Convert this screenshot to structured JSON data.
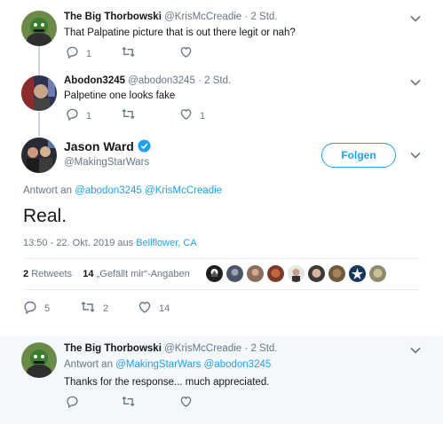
{
  "tweet1": {
    "name": "The Big Thorbowski",
    "handle": "@KrisMcCreadie",
    "sep": "·",
    "time": "2 Std.",
    "text": "That Palpatine picture that is out there legit or nah?",
    "reply_count": "1",
    "retweet_count": "",
    "like_count": ""
  },
  "tweet2": {
    "name": "Abodon3245",
    "handle": "@abodon3245",
    "sep": "·",
    "time": "2 Std.",
    "text": "Palpetine one looks fake",
    "reply_count": "1",
    "retweet_count": "",
    "like_count": "1"
  },
  "main": {
    "name": "Jason Ward",
    "handle": "@MakingStarWars",
    "follow_label": "Folgen",
    "reply_prefix": "Antwort an",
    "reply_mentions": "@abodon3245 @KrisMcCreadie",
    "text": "Real.",
    "timestamp": "13:50 - 22. Okt. 2019 aus",
    "location": "Bellflower, CA",
    "retweets_num": "2",
    "retweets_label": "Retweets",
    "likes_num": "14",
    "likes_label": "„Gefällt mir“-Angaben",
    "reply_count": "5",
    "retweet_count": "2",
    "like_count": "14"
  },
  "reply": {
    "name": "The Big Thorbowski",
    "handle": "@KrisMcCreadie",
    "sep": "·",
    "time": "2 Std.",
    "reply_prefix": "Antwort an",
    "reply_mentions": "@MakingStarWars @abodon3245",
    "text": "Thanks for the response... much appreciated.",
    "reply_count": "",
    "retweet_count": "",
    "like_count": ""
  },
  "colors": {
    "accent": "#1da1f2",
    "muted": "#657786",
    "verified": "#1da1f2"
  }
}
